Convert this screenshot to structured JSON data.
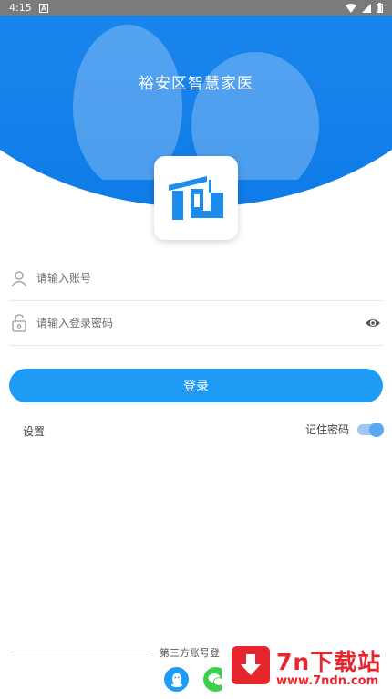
{
  "status_bar": {
    "time": "4:15",
    "icons": [
      "notification-a-icon",
      "wifi-icon",
      "signal-icon",
      "battery-icon"
    ]
  },
  "header": {
    "title": "裕安区智慧家医"
  },
  "form": {
    "account_placeholder": "请输入账号",
    "password_placeholder": "请输入登录密码",
    "login_label": "登录",
    "settings_label": "设置",
    "remember_label": "记住密码",
    "remember_on": true
  },
  "third_party": {
    "label": "第三方账号登",
    "providers": [
      "qq-icon",
      "wechat-icon"
    ]
  },
  "watermark": {
    "title": "7n下载站",
    "url": "www.7ndn.com"
  },
  "colors": {
    "primary": "#1d9bf5",
    "hero_blue": "#1a86ec",
    "wechat_green": "#3ccf4e",
    "watermark_red": "#e7252d"
  }
}
